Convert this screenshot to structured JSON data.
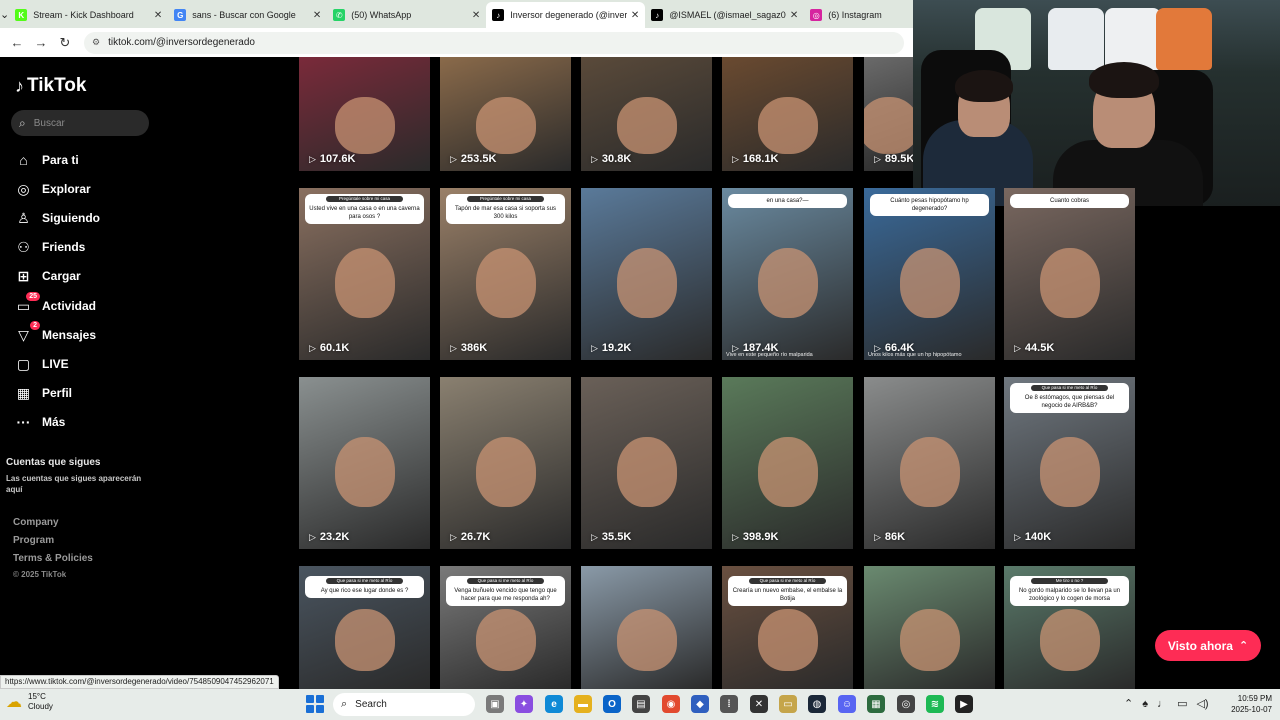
{
  "browser": {
    "tabs": [
      {
        "title": "Stream - Kick Dashboard",
        "favicon": "kick-icon",
        "color": "#53fc18",
        "glyph": "K"
      },
      {
        "title": "sans - Buscar con Google",
        "favicon": "google-icon",
        "color": "#4285f4",
        "glyph": "G"
      },
      {
        "title": "(50) WhatsApp",
        "favicon": "whatsapp-icon",
        "color": "#25d366",
        "glyph": "✆"
      },
      {
        "title": "Inversor degenerado (@inverso",
        "favicon": "tiktok-icon",
        "color": "#000000",
        "glyph": "♪"
      },
      {
        "title": "@ISMAEL (@ismael_sagaz01) |",
        "favicon": "tiktok-icon",
        "color": "#000000",
        "glyph": "♪"
      },
      {
        "title": "(6) Instagram",
        "favicon": "instagram-icon",
        "color": "#d6249f",
        "glyph": "◎"
      }
    ],
    "url": "tiktok.com/@inversordegenerado"
  },
  "sidebar": {
    "logo": "TikTok",
    "search_placeholder": "Buscar",
    "nav": [
      {
        "label": "Para ti",
        "icon": "home-icon",
        "glyph": "⌂"
      },
      {
        "label": "Explorar",
        "icon": "compass-icon",
        "glyph": "◎"
      },
      {
        "label": "Siguiendo",
        "icon": "person-icon",
        "glyph": "♙"
      },
      {
        "label": "Friends",
        "icon": "friends-icon",
        "glyph": "⚇"
      },
      {
        "label": "Cargar",
        "icon": "upload-icon",
        "glyph": "⊞"
      },
      {
        "label": "Actividad",
        "icon": "inbox-icon",
        "glyph": "▭",
        "badge": "25"
      },
      {
        "label": "Mensajes",
        "icon": "send-icon",
        "glyph": "▽",
        "badge": "2"
      },
      {
        "label": "LIVE",
        "icon": "live-icon",
        "glyph": "▢"
      },
      {
        "label": "Perfil",
        "icon": "profile-icon",
        "glyph": "▦"
      },
      {
        "label": "Más",
        "icon": "more-icon",
        "glyph": "···"
      }
    ],
    "following_title": "Cuentas que sigues",
    "following_desc": "Las cuentas que sigues aparecerán aquí",
    "footer": [
      "Company",
      "Program",
      "Terms & Policies"
    ],
    "copyright": "© 2025 TikTok"
  },
  "videos": [
    {
      "views": "107.6K"
    },
    {
      "views": "253.5K"
    },
    {
      "views": "30.8K"
    },
    {
      "views": "168.1K"
    },
    {
      "views": "89.5K"
    },
    {
      "views": "60.1K",
      "caption": "Usted vive en una casa o en una caverna para osos ?",
      "q": "Pregúntale sobre mi casa"
    },
    {
      "views": "386K",
      "caption": "Tapón de mar esa casa si soporta sus 300 kilos",
      "q": "Pregúntale sobre mi casa"
    },
    {
      "views": "19.2K"
    },
    {
      "views": "187.4K",
      "caption": "en una casa?—",
      "note": "Vive en este pequeño río malparida"
    },
    {
      "views": "66.4K",
      "caption": "Cuánto pesas hipopótamo hp degenerado?",
      "note": "Unos kilos más que un hp hipopótamo"
    },
    {
      "views": "44.5K",
      "caption": "Cuanto cobras"
    },
    {
      "views": "23.2K"
    },
    {
      "views": "26.7K"
    },
    {
      "views": "35.5K"
    },
    {
      "views": "398.9K"
    },
    {
      "views": "86K"
    },
    {
      "views": "140K",
      "caption": "Oe 8 estómagos, que piensas del negocio de AIRB&B?",
      "q": "Que pasa si me meto al Río"
    },
    {
      "views": "",
      "caption": "Ay que rico ese lugar donde es ?",
      "q": "Que pasa si me meto al Río"
    },
    {
      "views": "",
      "caption": "Venga buñuelo vencido que tengo que hacer para que me responda ah?",
      "q": "Que pasa si me meto al Río"
    },
    {
      "views": ""
    },
    {
      "views": "",
      "caption": "Crearía un nuevo embalse, el embalse la Botija",
      "q": "Que pasa si me meto al Río"
    },
    {
      "views": ""
    },
    {
      "views": "",
      "caption": "No gordo malparido se lo llevan pa un zoológico y lo cogen de morsa",
      "q": "Me tiro o no ?"
    }
  ],
  "visto_ahora": "Visto ahora",
  "status_url": "https://www.tiktok.com/@inversordegenerado/video/7548509047452962071",
  "taskbar": {
    "temp": "15°C",
    "weather": "Cloudy",
    "search": "Search",
    "time": "10:59 PM",
    "date": "2025-10-07"
  },
  "colors": {
    "accent": "#fe2c55"
  }
}
